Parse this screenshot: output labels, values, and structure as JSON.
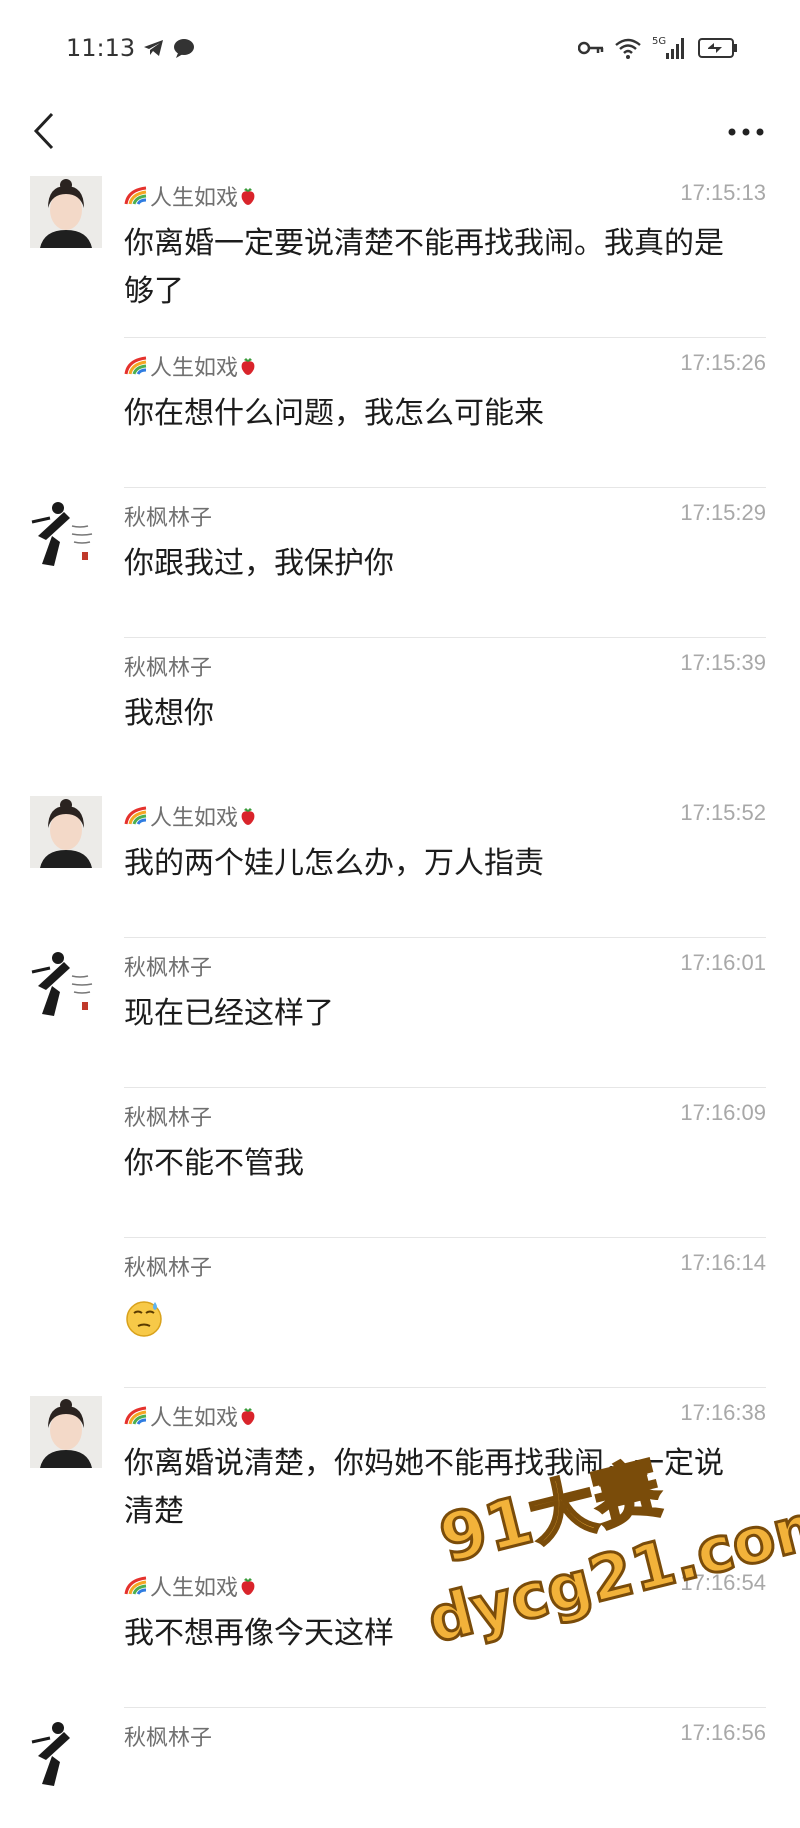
{
  "status_bar": {
    "time": "11:13",
    "network": "5G"
  },
  "nav": {
    "back_icon": "chevron-left-icon",
    "more_icon": "ellipsis-icon"
  },
  "messages": [
    {
      "sender": "人生如戏",
      "time": "17:15:13",
      "text": "你离婚一定要说清楚不能再找我闹。我真的是够了",
      "avatar": "female"
    },
    {
      "sender": "人生如戏",
      "time": "17:15:26",
      "text": "你在想什么问题，我怎么可能来",
      "avatar": ""
    },
    {
      "sender": "秋枫林子",
      "time": "17:15:29",
      "text": "你跟我过，我保护你",
      "avatar": "male"
    },
    {
      "sender": "秋枫林子",
      "time": "17:15:39",
      "text": "我想你",
      "avatar": ""
    },
    {
      "sender": "人生如戏",
      "time": "17:15:52",
      "text": "我的两个娃儿怎么办，万人指责",
      "avatar": "female"
    },
    {
      "sender": "秋枫林子",
      "time": "17:16:01",
      "text": "现在已经这样了",
      "avatar": "male"
    },
    {
      "sender": "秋枫林子",
      "time": "17:16:09",
      "text": "你不能不管我",
      "avatar": ""
    },
    {
      "sender": "秋枫林子",
      "time": "17:16:14",
      "text": "",
      "avatar": "",
      "emoji": "sweat-face-icon"
    },
    {
      "sender": "人生如戏",
      "time": "17:16:38",
      "text": "你离婚说清楚，你妈她不能再找我闹，一定说清楚",
      "avatar": "female"
    },
    {
      "sender": "人生如戏",
      "time": "17:16:54",
      "text": "我不想再像今天这样",
      "avatar": ""
    },
    {
      "sender": "秋枫林子",
      "time": "17:16:56",
      "text": "",
      "avatar": "male"
    }
  ],
  "watermark": {
    "line1": "91大赛",
    "line2": "dycg21.com"
  }
}
